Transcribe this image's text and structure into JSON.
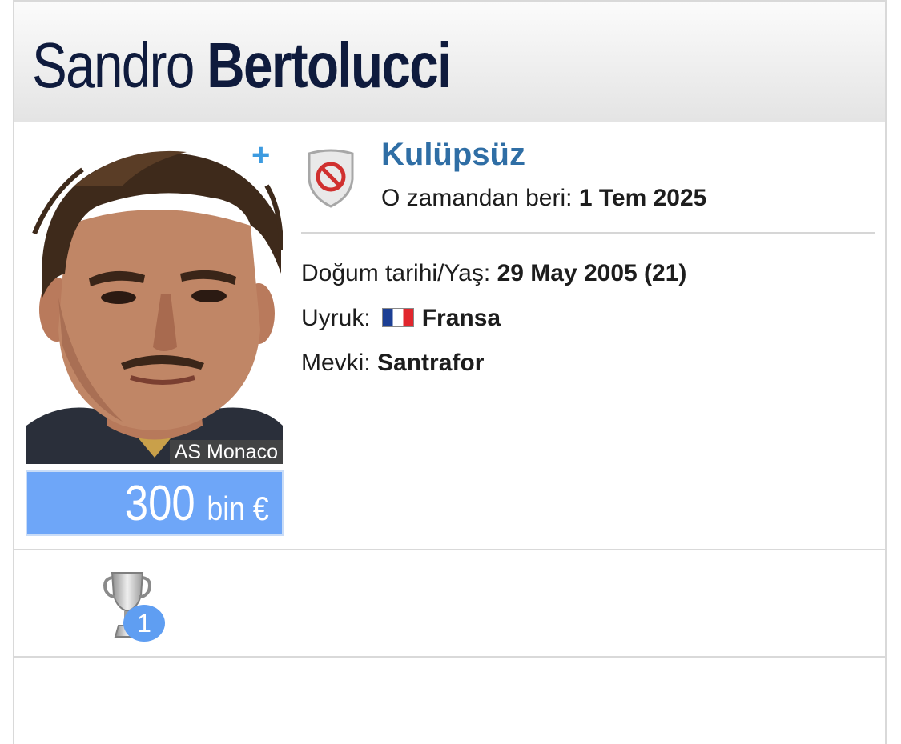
{
  "player": {
    "first_name": "Sandro",
    "last_name": "Bertolucci",
    "photo_club_caption": "AS Monaco",
    "market_value": {
      "amount": "300",
      "unit": "bin €"
    }
  },
  "club": {
    "name": "Kulüpsüz",
    "since_label": "O zamandan beri:",
    "since_value": "1 Tem 2025",
    "status_icon": "no-club-shield-icon"
  },
  "info": {
    "birth_label": "Doğum tarihi/Yaş:",
    "birth_value": "29 May 2005 (21)",
    "nationality_label": "Uyruk:",
    "nationality_value": "Fransa",
    "nationality_flag": "france-flag-icon",
    "position_label": "Mevki:",
    "position_value": "Santrafor"
  },
  "achievements": {
    "trophy_icon": "trophy-icon",
    "trophy_count": "1"
  },
  "colors": {
    "name_text": "#0f1b3d",
    "club_link": "#2f6ea5",
    "market_value_bg": "#6ea6f8",
    "plus_icon": "#3d9be0",
    "badge": "#5f9ef2"
  }
}
